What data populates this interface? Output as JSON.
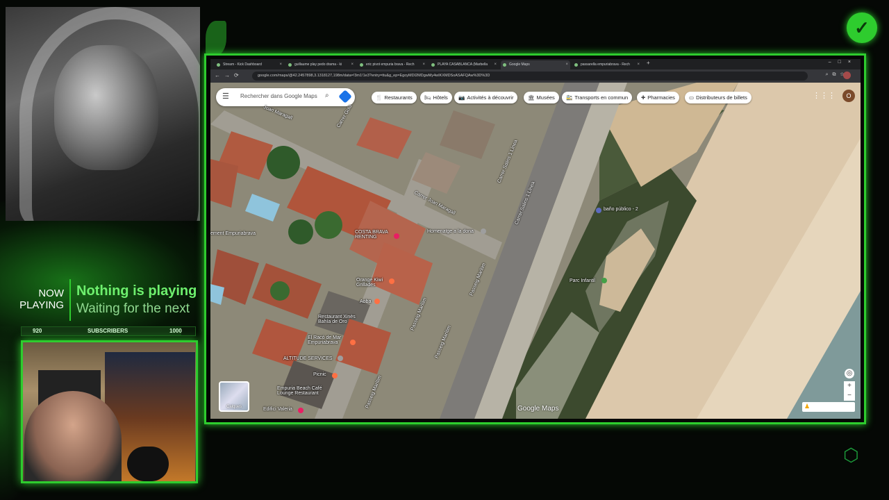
{
  "stream": {
    "now_playing_label": "NOW PLAYING",
    "now_playing_title": "Nothing is playing",
    "now_playing_sub": "Waiting for the next",
    "subscribers": {
      "current": "920",
      "label": "SUBSCRIBERS",
      "goal": "1000",
      "progress": 0.92
    },
    "accent": "#2ecc2e"
  },
  "browser": {
    "tabs": [
      {
        "label": "Stream - Kick Dashboard"
      },
      {
        "label": "guillaume play pedo drama - ki"
      },
      {
        "label": "eric pivot empuria brava - Rech"
      },
      {
        "label": "PLAYA CASABLANCA (Marbella"
      },
      {
        "label": "Google Maps"
      },
      {
        "label": "passarella empuriabrava - Rech"
      }
    ],
    "new_tab": "+",
    "url": "google.com/maps/@42.2457898,3.1318127,198m/data=!3m1!1e3?entry=ttu&g_ep=EgoyMDI2MDgwMy4wIKXMDSoASAFQAw%3D%3D"
  },
  "map": {
    "search_placeholder": "Rechercher dans Google Maps",
    "chips": [
      {
        "icon": "fork-knife-icon",
        "glyph": "🍴",
        "label": "Restaurants"
      },
      {
        "icon": "bed-icon",
        "glyph": "🛏",
        "label": "Hôtels"
      },
      {
        "icon": "camera-icon",
        "glyph": "📷",
        "label": "Activités à découvrir"
      },
      {
        "icon": "museum-icon",
        "glyph": "🏛",
        "label": "Musées"
      },
      {
        "icon": "transit-icon",
        "glyph": "🚉",
        "label": "Transports en commun"
      },
      {
        "icon": "pharmacy-icon",
        "glyph": "✚",
        "label": "Pharmacies"
      },
      {
        "icon": "atm-icon",
        "glyph": "▭",
        "label": "Distributeurs de billets"
      }
    ],
    "avatar_letter": "O",
    "labels": {
      "carrer_joan_maragall_1": "Joan Maragall",
      "carrer_joan_maragall_2": "Carrer Joan Maragall",
      "carrer_gola": "Carrer Gola",
      "carrer_salins_1": "Carrer Salins 1 Línea",
      "carrer_salins_2": "Carrer Salins 1 Línea",
      "passeig_maritim_1": "Passeig Marítim",
      "passeig_maritim_2": "Passeig Marítim",
      "passeig_maritim_3": "Passeig Marítim",
      "costa_brava_rent": "COSTA BRAVA RENTING",
      "homenatge": "Homenatge a la dona",
      "bano": "baño público - 2",
      "parc": "Parc Infantil",
      "orange_kiwi": "Orange Kiwi Grilladés",
      "aoba": "Aoba",
      "restaurant_xines": "Restaurant Xinès Bahía de Oro",
      "el_raco": "El Racó de Mar Empuriabrava",
      "altitude": "ALTITUDE SERVICES",
      "picnic": "Picnic",
      "empuria_beach": "Empuria Beach Café Lounge Restaurant",
      "edifici": "Edifici Valeria",
      "empuriabrava_left": "ement Empuriabrava",
      "carrer_bottom": "Passeig Marítim"
    },
    "layers_label": "Calques",
    "logo": "Google Maps"
  }
}
